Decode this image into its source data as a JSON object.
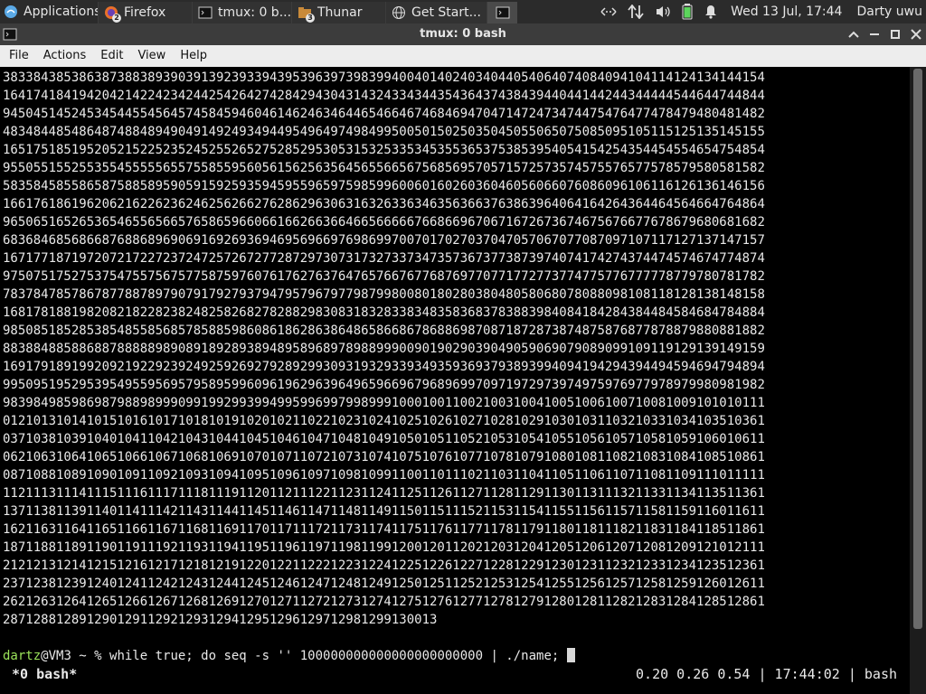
{
  "panel": {
    "apps_label": "Applications",
    "apps_menu_glyph": "☰",
    "tasks": [
      {
        "label": "Firefox",
        "icon": "firefox-icon",
        "badge": "2"
      },
      {
        "label": "tmux: 0 b...",
        "icon": "terminal-icon",
        "badge": ""
      },
      {
        "label": "Thunar",
        "icon": "thunar-icon",
        "badge": "3"
      },
      {
        "label": "Get Start...",
        "icon": "globe-icon",
        "badge": ""
      },
      {
        "label": "",
        "icon": "terminal-icon",
        "badge": ""
      }
    ],
    "clock": "Wed 13 Jul, 17:44",
    "user": "Darty uwu"
  },
  "window": {
    "title": "tmux: 0 bash",
    "menu": [
      "File",
      "Actions",
      "Edit",
      "View",
      "Help"
    ]
  },
  "terminal": {
    "output_lines": [
      "3833843853863873883893903913923933943953963973983994004014024034044054064074084094104114124134144154",
      "1641741841942042142242342442542642742842943043143243343443543643743843944044144244344444544644744844",
      "9450451452453454455456457458459460461462463464465466467468469470471472473474475476477478479480481482",
      "4834844854864874884894904914924934944954964974984995005015025035045055065075085095105115125135145155",
      "1651751851952052152252352452552652752852953053153253353453553653753853954054154254354454554654754854",
      "9550551552553554555556557558559560561562563564565566567568569570571572573574575576577578579580581582",
      "5835845855865875885895905915925935945955965975985996006016026036046056066076086096106116126136146156",
      "1661761861962062162262362462562662762862963063163263363463563663763863964064164264364464564664764864",
      "9650651652653654655656657658659660661662663664665666667668669670671672673674675676677678679680681682",
      "6836846856866876886896906916926936946956966976986997007017027037047057067077087097107117127137147157",
      "1671771871972072172272372472572672772872973073173273373473573673773873974074174274374474574674774874",
      "9750751752753754755756757758759760761762763764765766767768769770771772773774775776777778779780781782",
      "7837847857867877887897907917927937947957967977987998008018028038048058068078088098108118128138148158",
      "1681781881982082182282382482582682782882983083183283383483583683783883984084184284384484584684784884",
      "9850851852853854855856857858859860861862863864865866867868869870871872873874875876877878879880881882",
      "8838848858868878888898908918928938948958968978988999009019029039049059069079089099109119129139149159",
      "1691791891992092192292392492592692792892993093193293393493593693793893994094194294394494594694794894",
      "9950951952953954955956957958959960961962963964965966967968969970971972973974975976977978979980981982",
      "9839849859869879889899909919929939949959969979989991000100110021003100410051006100710081009101010111",
      "0121013101410151016101710181019102010211022102310241025102610271028102910301031103210331034103510361",
      "0371038103910401041104210431044104510461047104810491050105110521053105410551056105710581059106010611",
      "0621063106410651066106710681069107010711072107310741075107610771078107910801081108210831084108510861",
      "0871088108910901091109210931094109510961097109810991100110111021103110411051106110711081109111011111",
      "1121113111411151116111711181119112011211122112311241125112611271128112911301131113211331134113511361",
      "1371138113911401141114211431144114511461147114811491150115111521153115411551156115711581159116011611",
      "1621163116411651166116711681169117011711172117311741175117611771178117911801181118211831184118511861",
      "1871188118911901191119211931194119511961197119811991200120112021203120412051206120712081209121012111",
      "2121213121412151216121712181219122012211222122312241225122612271228122912301231123212331234123512361",
      "2371238123912401241124212431244124512461247124812491250125112521253125412551256125712581259126012611",
      "2621263126412651266126712681269127012711272127312741275127612771278127912801281128212831284128512861",
      "287128812891290129112921293129412951296129712981299130013"
    ],
    "prompt_user": "dartz",
    "prompt_rest": "@VM3 ~ % ",
    "command": "while true; do seq -s '' 100000000000000000000000 | ./name;",
    "status_left": "*0 bash*",
    "status_right": "0.20 0.26 0.54 | 17:44:02 | bash"
  }
}
